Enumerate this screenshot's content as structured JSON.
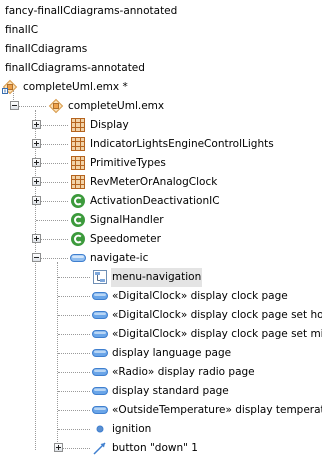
{
  "tree": {
    "rows": [
      {
        "label": "fancy-finalICdiagrams-annotated",
        "icon": "none"
      },
      {
        "label": "finalIC",
        "icon": "none"
      },
      {
        "label": "finalICdiagrams",
        "icon": "none"
      },
      {
        "label": "finalICdiagrams-annotated",
        "icon": "none"
      },
      {
        "label": "completeUml.emx *",
        "icon": "uml-model-file-icon"
      },
      {
        "label": "completeUml.emx",
        "icon": "uml-model-icon",
        "expander": "collapse"
      },
      {
        "label": "Display",
        "icon": "package-icon",
        "expander": "expand"
      },
      {
        "label": "IndicatorLightsEngineControlLights",
        "icon": "package-icon",
        "expander": "expand"
      },
      {
        "label": "PrimitiveTypes",
        "icon": "package-icon",
        "expander": "expand"
      },
      {
        "label": "RevMeterOrAnalogClock",
        "icon": "package-icon",
        "expander": "expand"
      },
      {
        "label": "ActivationDeactivationIC",
        "icon": "class-icon",
        "expander": "expand"
      },
      {
        "label": "SignalHandler",
        "icon": "class-icon"
      },
      {
        "label": "Speedometer",
        "icon": "class-icon",
        "expander": "expand"
      },
      {
        "label": "navigate-ic",
        "icon": "state-machine-icon",
        "expander": "collapse"
      },
      {
        "label": "menu-navigation",
        "icon": "diagram-icon",
        "selected": true
      },
      {
        "label": "«DigitalClock» display clock page",
        "icon": "state-icon"
      },
      {
        "label": "«DigitalClock» display clock page set hour",
        "icon": "state-icon"
      },
      {
        "label": "«DigitalClock» display clock page set minute",
        "icon": "state-icon"
      },
      {
        "label": "display language page",
        "icon": "state-icon"
      },
      {
        "label": "«Radio» display radio page",
        "icon": "state-icon"
      },
      {
        "label": "display standard page",
        "icon": "state-icon"
      },
      {
        "label": "«OutsideTemperature» display temperature page",
        "icon": "state-icon"
      },
      {
        "label": "ignition",
        "icon": "initial-state-icon"
      },
      {
        "label": "button \"down\" 1",
        "icon": "transition-icon",
        "expander": "expand"
      }
    ],
    "colors": {
      "selection": "#e4e4e4",
      "package": "#b5641f",
      "class": "#3c9a3c",
      "state": "#3f7fcf",
      "model": "#d89a4a"
    }
  }
}
